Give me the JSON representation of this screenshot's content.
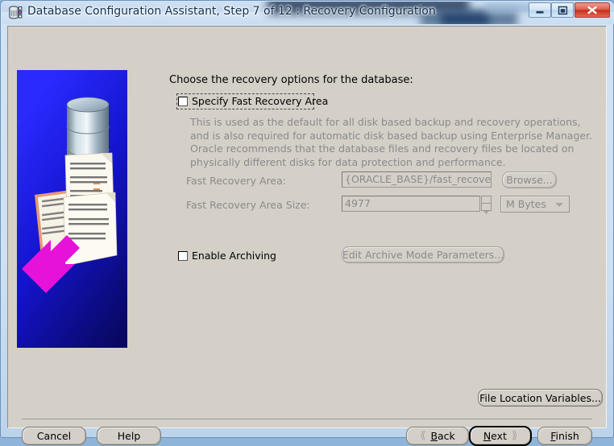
{
  "window": {
    "title": "Database Configuration Assistant, Step 7 of 12 : Recovery Configuration",
    "icon": "database-app-icon",
    "controls": {
      "minimize": "minimize-icon",
      "maximize": "restore-icon",
      "close": "close-icon"
    }
  },
  "sidebar": {
    "graphic_name": "database-documents-illustration",
    "colors": {
      "background_blue": "#1717e0",
      "arrow_magenta": "#e612d9",
      "cylinder_steel": "#aebfcc"
    }
  },
  "main": {
    "heading": "Choose the recovery options for the database:",
    "specify_fra": {
      "label": "Specify Fast Recovery Area",
      "checked": false,
      "focused": true
    },
    "description": "This is used as the default for all disk based backup and recovery operations, and is also required for automatic disk based backup using Enterprise Manager. Oracle recommends that the database files and recovery files be located on physically different disks for data protection and performance.",
    "fields": [
      {
        "label": "Fast Recovery Area:",
        "value": "{ORACLE_BASE}/fast_recovery_a",
        "disabled": true
      },
      {
        "label": "Fast Recovery Area Size:",
        "value": "4977",
        "disabled": true
      }
    ],
    "units_dropdown": {
      "selected": "M Bytes",
      "disabled": true
    },
    "browse_button": {
      "label": "Browse...",
      "disabled": true
    },
    "enable_archiving": {
      "label": "Enable Archiving",
      "checked": false
    },
    "edit_archive_button": {
      "label": "Edit Archive Mode Parameters...",
      "disabled": true
    },
    "file_location_button": {
      "label": "File Location Variables..."
    }
  },
  "footer": {
    "cancel": "Cancel",
    "help": "Help",
    "back": "Back",
    "back_mnemonic": "B",
    "next": "Next",
    "next_mnemonic": "N",
    "finish": "Finish",
    "finish_mnemonic": "F",
    "back_chevron": "chevron-left-icon",
    "next_chevron": "chevron-right-icon",
    "default_button": "Next"
  }
}
